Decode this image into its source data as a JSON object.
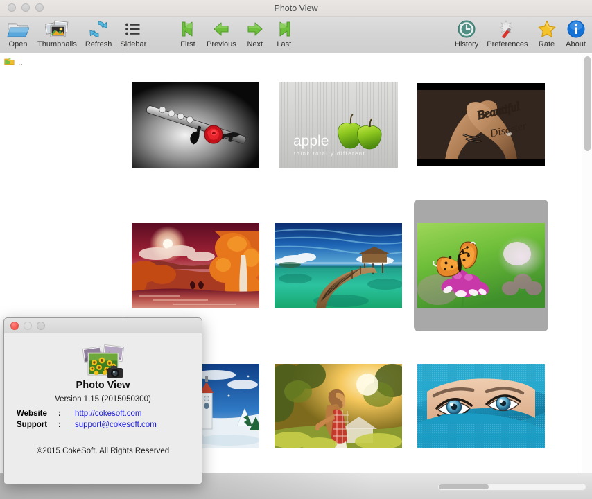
{
  "window": {
    "title": "Photo View",
    "traffic_lights": [
      "close",
      "minimize",
      "zoom"
    ]
  },
  "toolbar": {
    "left_items": [
      {
        "label": "Open",
        "icon": "open-folder-icon"
      },
      {
        "label": "Thumbnails",
        "icon": "thumbnails-icon"
      },
      {
        "label": "Refresh",
        "icon": "refresh-icon"
      },
      {
        "label": "Sidebar",
        "icon": "sidebar-list-icon"
      }
    ],
    "nav_items": [
      {
        "label": "First",
        "icon": "first-arrow-icon"
      },
      {
        "label": "Previous",
        "icon": "previous-arrow-icon"
      },
      {
        "label": "Next",
        "icon": "next-arrow-icon"
      },
      {
        "label": "Last",
        "icon": "last-arrow-icon"
      }
    ],
    "right_items": [
      {
        "label": "History",
        "icon": "history-clock-icon"
      },
      {
        "label": "Preferences",
        "icon": "preferences-wand-icon"
      },
      {
        "label": "Rate",
        "icon": "star-icon"
      },
      {
        "label": "About",
        "icon": "info-icon"
      }
    ]
  },
  "sidebar": {
    "items": [
      {
        "label": "..",
        "icon": "folder-icon"
      }
    ]
  },
  "thumbnails": {
    "items": [
      {
        "name": "flute-red-rose",
        "selected": false
      },
      {
        "name": "apple-think-totally-different",
        "selected": false
      },
      {
        "name": "beautiful-disaster-tattoo",
        "selected": false
      },
      {
        "name": "autumn-waterfall-landscape",
        "selected": false
      },
      {
        "name": "tropical-pier-over-water",
        "selected": false
      },
      {
        "name": "butterfly-on-pink-clover",
        "selected": true
      },
      {
        "name": "winter-church-snow",
        "selected": false
      },
      {
        "name": "girl-in-plaid-sunset",
        "selected": false
      },
      {
        "name": "blue-eyes-teal-veil",
        "selected": false
      }
    ],
    "selection_color": "#a8a8a8"
  },
  "scrollbars": {
    "vertical_thumb_percent": 23,
    "horizontal_thumb_percent": 33
  },
  "about_dialog": {
    "traffic_lights": [
      "close",
      "minimize",
      "zoom"
    ],
    "app_name": "Photo View",
    "version": "Version 1.15 (2015050300)",
    "website_label": "Website",
    "support_label": "Support",
    "colon": ":",
    "website_url": "http://cokesoft.com",
    "support_email": "support@cokesoft.com",
    "copyright": "©2015 CokeSoft. All Rights Reserved",
    "link_color": "#1414e0"
  }
}
